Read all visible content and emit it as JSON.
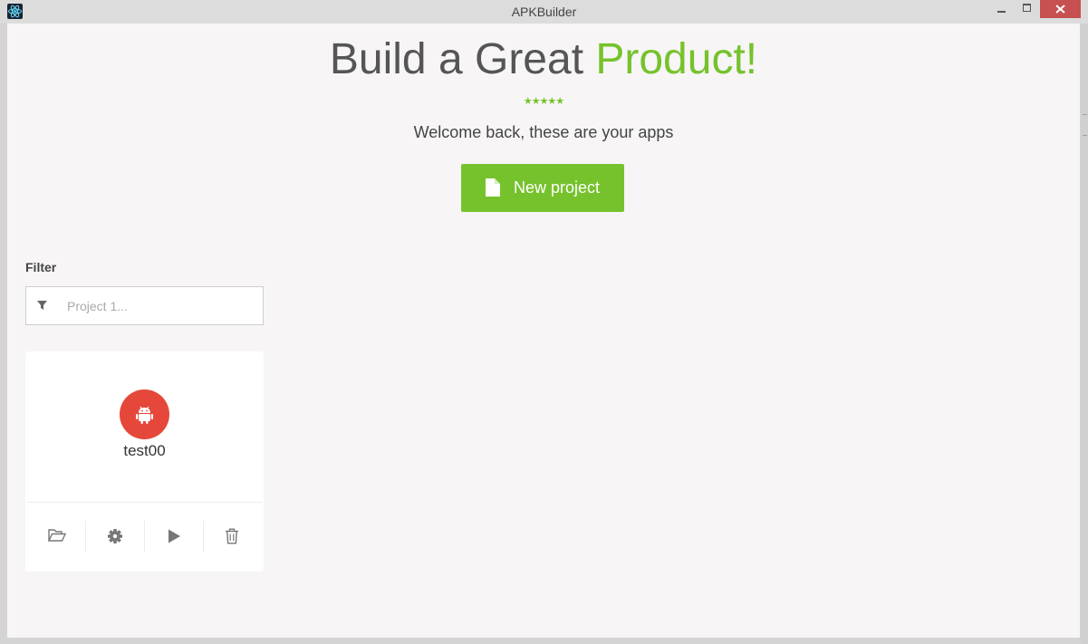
{
  "window": {
    "title": "APKBuilder",
    "icon": "react-atom-icon"
  },
  "hero": {
    "headline_main": "Build a Great ",
    "headline_accent": "Product!",
    "stars": "★★★★★",
    "subtitle": "Welcome back, these are your apps",
    "new_project_label": "New project"
  },
  "filter": {
    "label": "Filter",
    "placeholder": "Project 1...",
    "value": ""
  },
  "projects": [
    {
      "name": "test00",
      "icon": "android-icon",
      "actions": [
        "open-folder-icon",
        "gear-icon",
        "play-icon",
        "trash-icon"
      ]
    }
  ],
  "colors": {
    "accent": "#76c22c",
    "avatar": "#e5483a",
    "background": "#f7f5f6",
    "close_button": "#c75050"
  }
}
